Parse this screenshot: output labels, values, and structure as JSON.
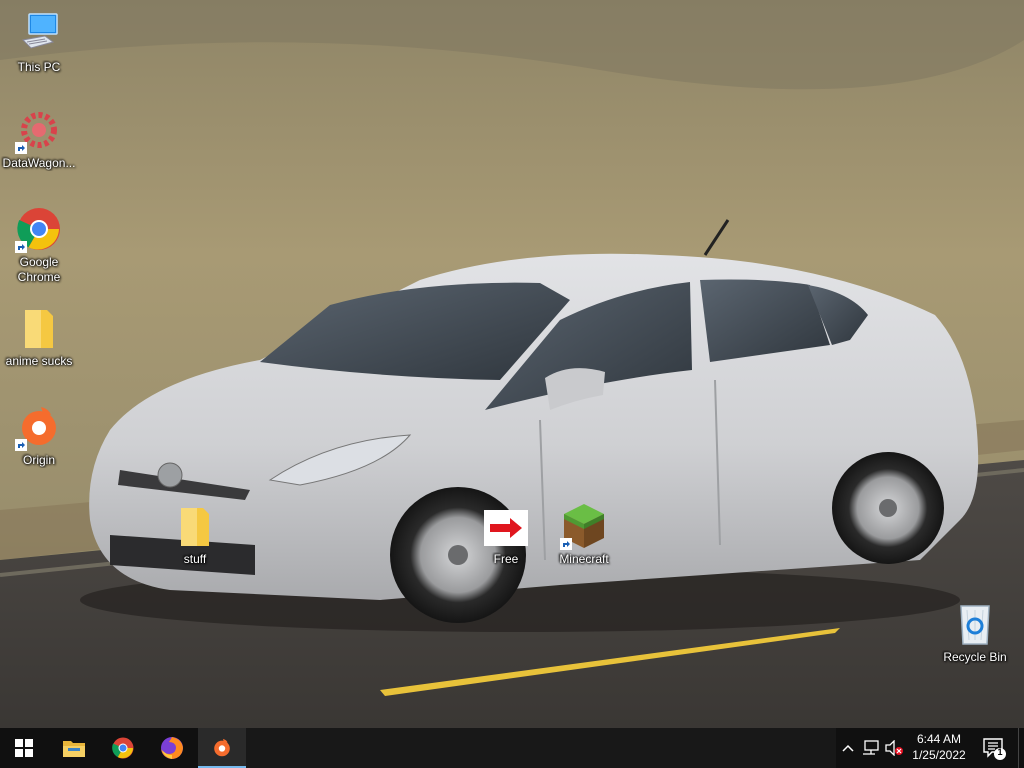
{
  "desktop": {
    "icons": [
      {
        "id": "this-pc",
        "label": "This PC"
      },
      {
        "id": "datawagon",
        "label": "DataWagon..."
      },
      {
        "id": "google-chrome",
        "label": "Google Chrome"
      },
      {
        "id": "anime-sucks",
        "label": "anime sucks"
      },
      {
        "id": "origin",
        "label": "Origin"
      },
      {
        "id": "stuff",
        "label": "stuff"
      },
      {
        "id": "free",
        "label": "Free"
      },
      {
        "id": "minecraft",
        "label": "Minecraft"
      },
      {
        "id": "recycle-bin",
        "label": "Recycle Bin"
      }
    ]
  },
  "taskbar": {
    "pinned": [
      "windows-start-icon",
      "file-explorer-icon",
      "chrome-icon",
      "firefox-icon",
      "origin-icon"
    ],
    "active_app": "origin-icon",
    "tray": {
      "chevron": "chevron-up-icon",
      "network": "network-icon",
      "volume": "volume-muted-icon"
    },
    "clock": {
      "time": "6:44 AM",
      "date": "1/25/2022"
    },
    "notifications": {
      "count": "1"
    }
  },
  "colors": {
    "taskbar_bg": "#101010",
    "active_indicator": "#76b9ed",
    "folder_yellow": "#f5c842"
  }
}
